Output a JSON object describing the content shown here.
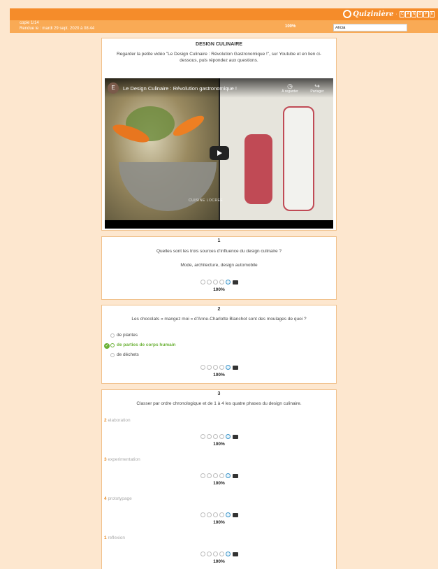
{
  "header": {
    "logo_text": "Quizinière",
    "logo_sep": "·",
    "logo_canope": [
      "C",
      "A",
      "N",
      "O",
      "P",
      "É"
    ]
  },
  "subheader": {
    "copie": "copie 1/14",
    "rendue": "Rendue le : mardi 29 sept. 2020 à 08:44",
    "percent": "100%",
    "student_name": "Alicia"
  },
  "intro": {
    "title": "DESIGN CULINAIRE",
    "text": "Regarder la petite vidéo \"Le Design Culinaire : Révolution Gastronomique !\", sur Youtube et en lien ci-dessous, puis répondez aux questions.",
    "video": {
      "channel_initial": "E",
      "title": "Le Design Culinaire : Révolution gastronomique !",
      "later_label": "À regarder",
      "share_label": "Partager",
      "caption": "CUISINE LOCREE"
    }
  },
  "questions": [
    {
      "number": "1",
      "text": "Quelles sont les trois sources d'influence du design culinaire ?",
      "answer": "Mode, architecture, design automobile",
      "percent": "100%"
    },
    {
      "number": "2",
      "text": "Les chocolats « mangez moi » d'Anne-Charlotte Blanchot sont des moulages de quoi ?",
      "options": [
        "de plantes",
        "de parties de corps humain",
        "de déchets"
      ],
      "percent": "100%"
    },
    {
      "number": "3",
      "text": "Classer par ordre chronologique et de 1 à 4 les quatre phases du design culinaire.",
      "phases": [
        {
          "rank": "2",
          "label": "elaboration",
          "percent": "100%"
        },
        {
          "rank": "3",
          "label": "experimentation",
          "percent": "100%"
        },
        {
          "rank": "4",
          "label": "prototypage",
          "percent": "100%"
        },
        {
          "rank": "1",
          "label": "reflexion",
          "percent": "100%"
        }
      ]
    }
  ],
  "colors": {
    "topbar": "#f58c2a",
    "subbar": "#f9aa55",
    "background": "#fde7cf",
    "correct": "#6bb136",
    "selected_rating": "#3a94c9"
  }
}
